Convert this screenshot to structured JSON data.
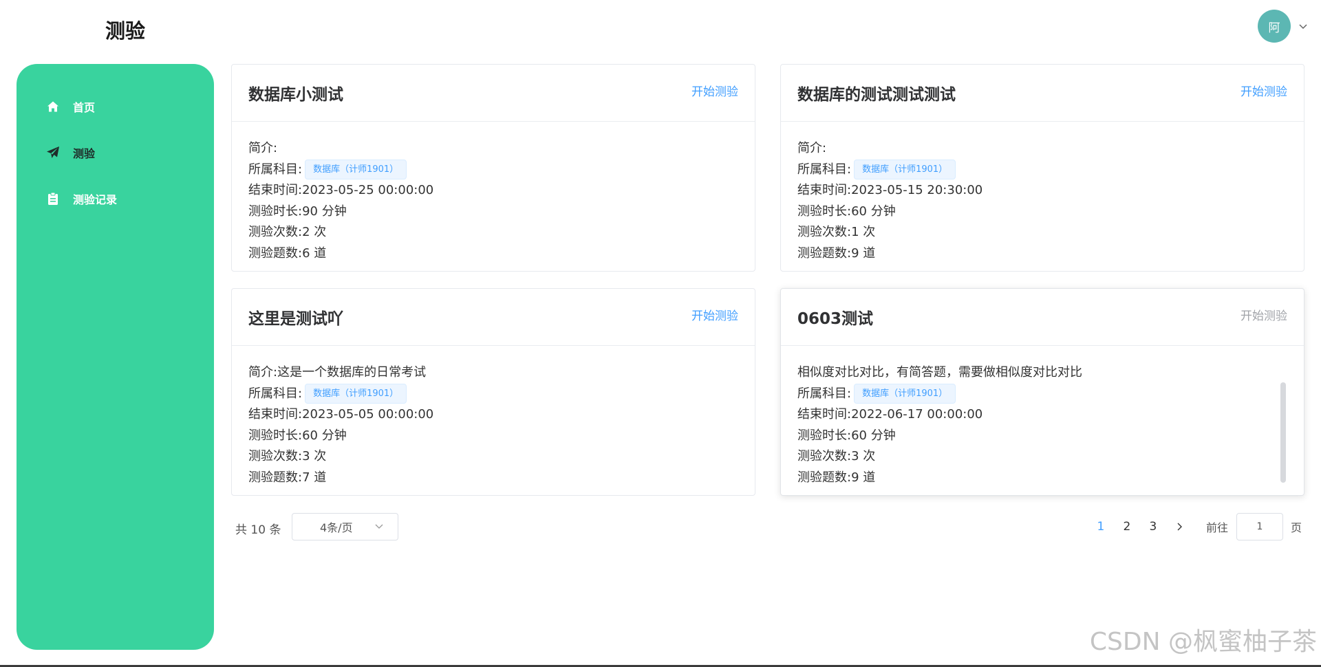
{
  "header": {
    "title": "测验",
    "avatar_text": "阿",
    "avatar_color": "#5cb7b3"
  },
  "sidebar": {
    "background": "#39d39e",
    "items": [
      {
        "label": "首页",
        "icon": "home-icon",
        "active": false
      },
      {
        "label": "测验",
        "icon": "paper-plane-icon",
        "active": true
      },
      {
        "label": "测验记录",
        "icon": "clipboard-icon",
        "active": false
      }
    ]
  },
  "labels": {
    "intro": "简介:",
    "subject": "所属科目:",
    "end_time": "结束时间:",
    "duration": "测验时长:",
    "attempts": "测验次数:",
    "questions": "测验题数:"
  },
  "quizzes": [
    {
      "title": "数据库小测试",
      "action": "开始测验",
      "intro": "",
      "subject": "数据库（计师1901）",
      "end_time": "2023-05-25 00:00:00",
      "duration": "90 分钟",
      "attempts": "2 次",
      "questions": "6 道"
    },
    {
      "title": "数据库的测试测试测试",
      "action": "开始测验",
      "intro": "",
      "subject": "数据库（计师1901）",
      "end_time": "2023-05-15 20:30:00",
      "duration": "60 分钟",
      "attempts": "1 次",
      "questions": "9 道"
    },
    {
      "title": "这里是测试吖",
      "action": "开始测验",
      "intro": "这是一个数据库的日常考试",
      "subject": "数据库（计师1901）",
      "end_time": "2023-05-05 00:00:00",
      "duration": "60 分钟",
      "attempts": "3 次",
      "questions": "7 道"
    },
    {
      "title": "0603测试",
      "action": "开始测验",
      "intro_overflow": "相似度对比对比，有简答题，需要做相似度对比对比",
      "subject": "数据库（计师1901）",
      "end_time": "2022-06-17 00:00:00",
      "duration": "60 分钟",
      "attempts": "3 次",
      "questions": "9 道"
    }
  ],
  "pagination": {
    "total": "共 10 条",
    "page_size": "4条/页",
    "pages": [
      "1",
      "2",
      "3"
    ],
    "current": "1",
    "goto_label": "前往",
    "goto_value": "1",
    "page_unit": "页"
  },
  "watermark": "CSDN @枫蜜柚子茶",
  "colors": {
    "accent": "#409eff",
    "tag_bg": "#ecf5ff"
  }
}
